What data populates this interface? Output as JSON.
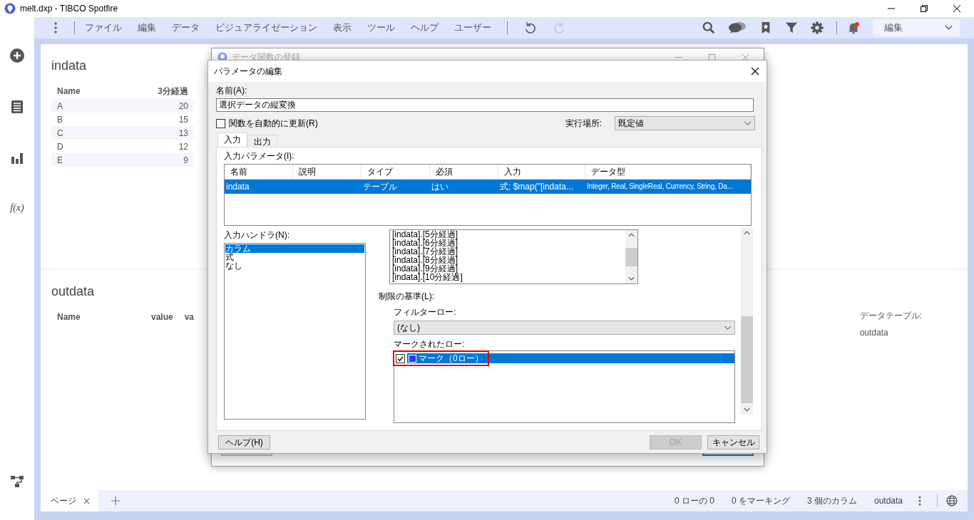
{
  "window": {
    "title": "melt.dxp - TIBCO Spotfire"
  },
  "menu": {
    "items": [
      "ファイル",
      "編集",
      "データ",
      "ビジュアライゼーション",
      "表示",
      "ツール",
      "ヘルプ",
      "ユーザー"
    ]
  },
  "history_buttons": [
    {
      "kind": "undo",
      "disabled": false
    },
    {
      "kind": "redo",
      "disabled": true
    }
  ],
  "notifications": {
    "unread": true
  },
  "mode_dropdown": {
    "value": "編集"
  },
  "sidebar": {
    "function_label": "f(x)"
  },
  "canvas": {
    "tables": [
      {
        "title": "indata",
        "columns": [
          "Name",
          "3分経過"
        ],
        "rows": [
          [
            "A",
            "20"
          ],
          [
            "B",
            "15"
          ],
          [
            "C",
            "13"
          ],
          [
            "D",
            "12"
          ],
          [
            "E",
            "9"
          ]
        ]
      },
      {
        "title": "outdata",
        "columns": [
          "Name",
          "value",
          "va"
        ]
      }
    ],
    "details": {
      "label": "データテーブル:",
      "value": "outdata"
    }
  },
  "parent_dialog": {
    "title": "データ関数の登録"
  },
  "dialog": {
    "title": "パラメータの編集",
    "name_label": "名前(A):",
    "name_value": "選択データの縦変換",
    "auto_update": {
      "label": "関数を自動的に更新(R)",
      "checked": false
    },
    "location": {
      "label": "実行場所:",
      "value": "既定値"
    },
    "tabs": [
      {
        "label": "入力",
        "selected": true
      },
      {
        "label": "出力",
        "selected": false
      }
    ],
    "params_label": "入力パラメータ(I):",
    "params_columns": [
      "名前",
      "説明",
      "タイプ",
      "必須",
      "入力",
      "データ型"
    ],
    "params_rows": [
      {
        "cells": [
          "indata",
          "",
          "テーブル",
          "はい",
          "式: $map(\"[indata...",
          "Integer, Real, SingleReal, Currency, String, Da..."
        ],
        "selected": true
      }
    ],
    "handler_label": "入力ハンドラ(N):",
    "handlers": [
      {
        "label": "カラム",
        "selected": true
      },
      {
        "label": "式",
        "selected": false
      },
      {
        "label": "なし",
        "selected": false
      }
    ],
    "columns_list": [
      "[indata].[5分経過]",
      "[indata].[6分経過]",
      "[indata].[7分経過]",
      "[indata].[8分経過]",
      "[indata].[9分経過]",
      "[indata].[10分経過]"
    ],
    "limit_label": "制限の基準(L):",
    "filter_label": "フィルターロー:",
    "filter_value": "(なし)",
    "marked_label": "マークされたロー:",
    "marked_items": [
      {
        "label": "マーク（0ロー）",
        "checked": true,
        "selected": true,
        "color": "#3434f0",
        "highlighted": true
      }
    ],
    "buttons": [
      {
        "label": "ヘルプ(H)",
        "disabled": false
      },
      {
        "label": "OK",
        "disabled": true
      },
      {
        "label": "キャンセル",
        "disabled": false
      }
    ]
  },
  "status_bar": {
    "pages": [
      {
        "label": "ページ",
        "selected": true
      }
    ],
    "items": [
      "0 ローの 0",
      "0 をマーキング",
      "3 個のカラム",
      "outdata"
    ]
  }
}
